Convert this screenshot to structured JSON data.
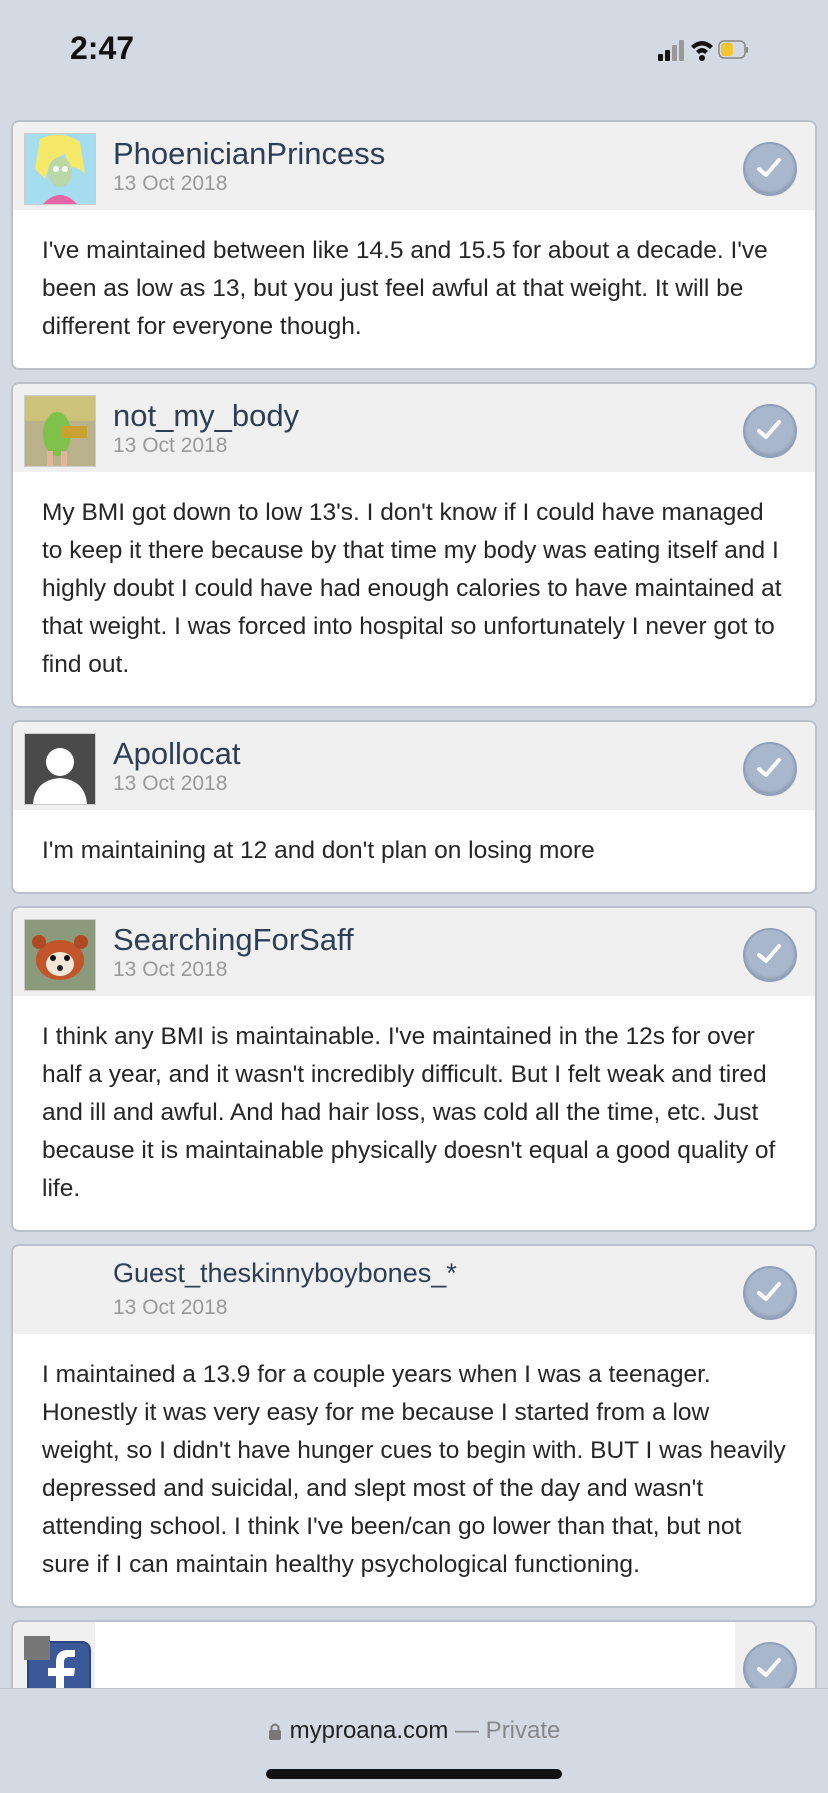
{
  "status": {
    "time": "2:47"
  },
  "posts": [
    {
      "author": "PhoenicianPrincess",
      "date": "13 Oct 2018",
      "body": "I've maintained between like 14.5 and 15.5 for about a decade. I've been as low as 13, but you just feel awful at that weight. It will be different for everyone though."
    },
    {
      "author": "not_my_body",
      "date": "13 Oct 2018",
      "body": "My BMI got down to low 13's. I don't know if I could have managed to keep it there because by that time my body was eating itself and I highly doubt I could have had enough calories to have maintained at that weight. I was forced into hospital so unfortunately I never got to find out."
    },
    {
      "author": "Apollocat",
      "date": "13 Oct 2018",
      "body": "I'm maintaining at 12 and don't plan on losing more"
    },
    {
      "author": "SearchingForSaff",
      "date": "13 Oct 2018",
      "body": "I think any BMI is maintainable. I've maintained in the 12s for over half a year, and it wasn't incredibly difficult. But I felt weak and tired and ill and awful. And had hair loss, was cold all the time, etc. Just because it is maintainable physically doesn't equal a good quality of life."
    },
    {
      "author": "Guest_theskinnyboybones_*",
      "date": "13 Oct 2018",
      "body": "I maintained a 13.9 for a couple years when I was a teenager. Honestly it was very easy for me because I started from a low weight, so I didn't have hunger cues to begin with. BUT I was heavily depressed and suicidal, and slept most of the day and wasn't attending school. I think I've been/can go lower than that, but not sure if I can maintain healthy psychological functioning."
    }
  ],
  "browser": {
    "domain": "myproana.com",
    "privacy": "— Private"
  }
}
